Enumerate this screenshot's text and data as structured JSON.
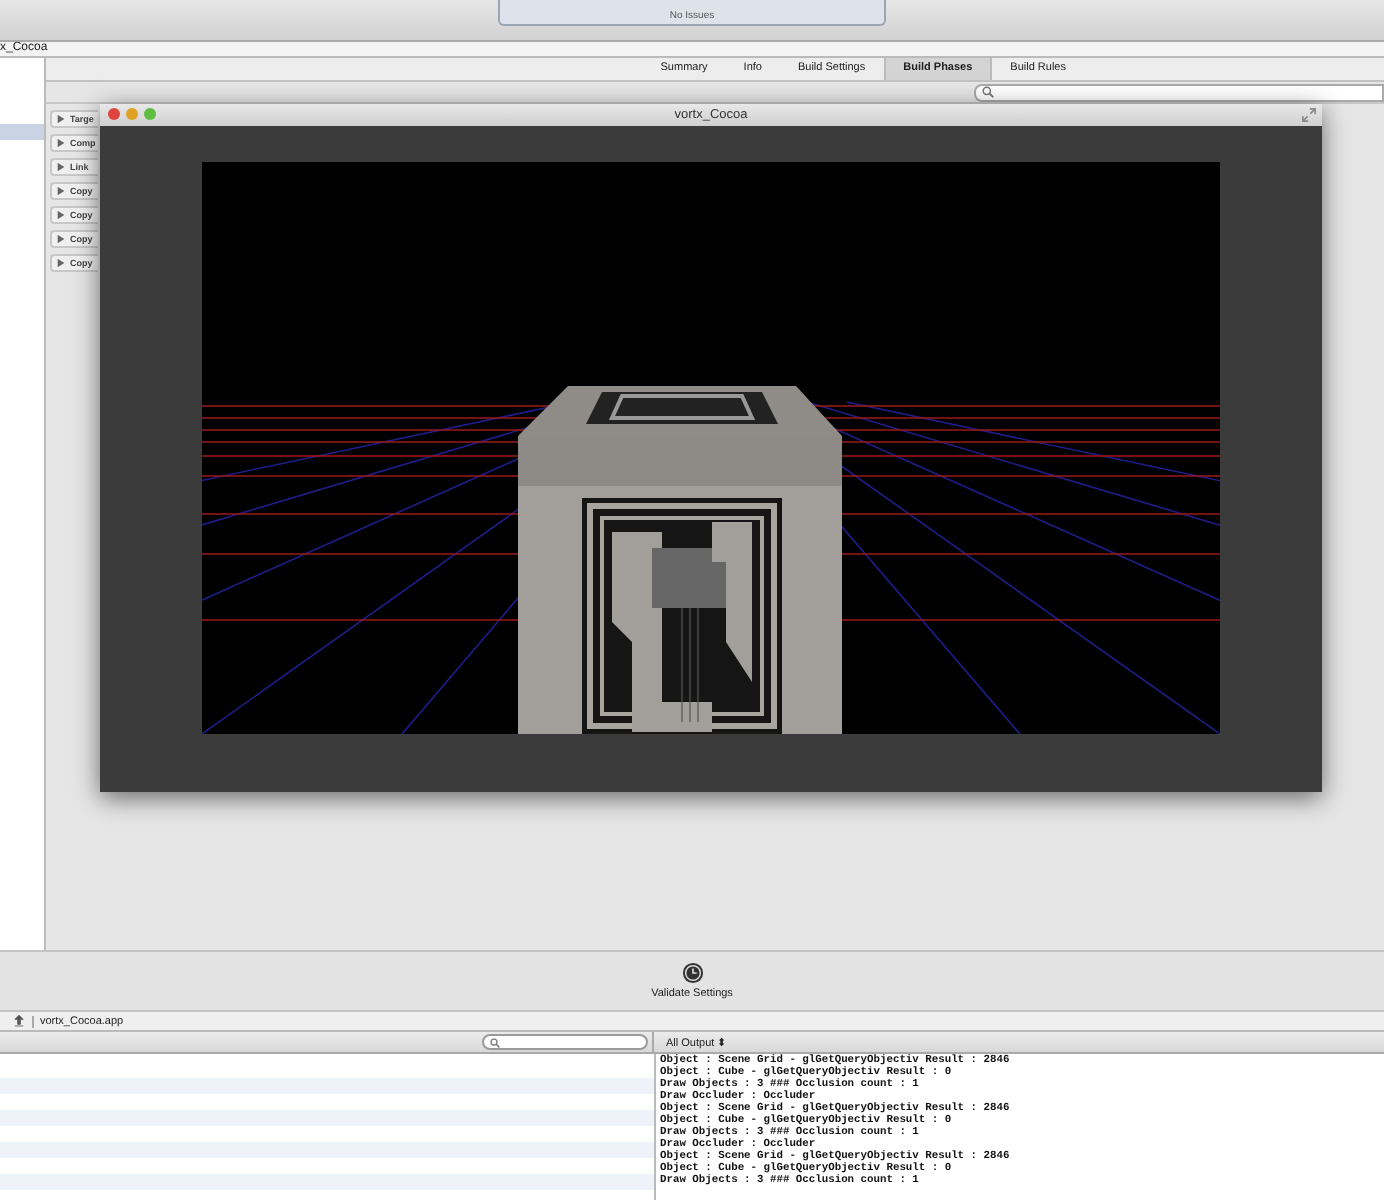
{
  "toolbar": {
    "status": "No Issues"
  },
  "jump_bar": {
    "title": "x_Cocoa"
  },
  "tabs": [
    {
      "label": "Summary",
      "selected": false
    },
    {
      "label": "Info",
      "selected": false
    },
    {
      "label": "Build Settings",
      "selected": false
    },
    {
      "label": "Build Phases",
      "selected": true
    },
    {
      "label": "Build Rules",
      "selected": false
    }
  ],
  "phases": [
    {
      "label": "Targe",
      "expanded": false
    },
    {
      "label": "Comp",
      "expanded": false
    },
    {
      "label": "Link",
      "expanded": false
    },
    {
      "label": "Copy",
      "expanded": false
    },
    {
      "label": "Copy",
      "expanded": false
    },
    {
      "label": "Copy",
      "expanded": false
    },
    {
      "label": "Copy",
      "expanded": false
    }
  ],
  "app_window": {
    "title": "vortx_Cocoa"
  },
  "validate": {
    "label": "Validate Settings"
  },
  "debug_bar": {
    "target": "vortx_Cocoa.app",
    "output_filter": "All Output ⬍"
  },
  "console": {
    "lines": [
      "Object : Scene Grid - glGetQueryObjectiv Result : 2846",
      "Object : Cube - glGetQueryObjectiv Result : 0",
      "Draw Objects : 3 ### Occlusion count : 1",
      "Draw Occluder : Occluder",
      "Object : Scene Grid - glGetQueryObjectiv Result : 2846",
      "Object : Cube - glGetQueryObjectiv Result : 0",
      "Draw Objects : 3 ### Occlusion count : 1",
      "Draw Occluder : Occluder",
      "Object : Scene Grid - glGetQueryObjectiv Result : 2846",
      "Object : Cube - glGetQueryObjectiv Result : 0",
      "Draw Objects : 3 ### Occlusion count : 1"
    ]
  }
}
